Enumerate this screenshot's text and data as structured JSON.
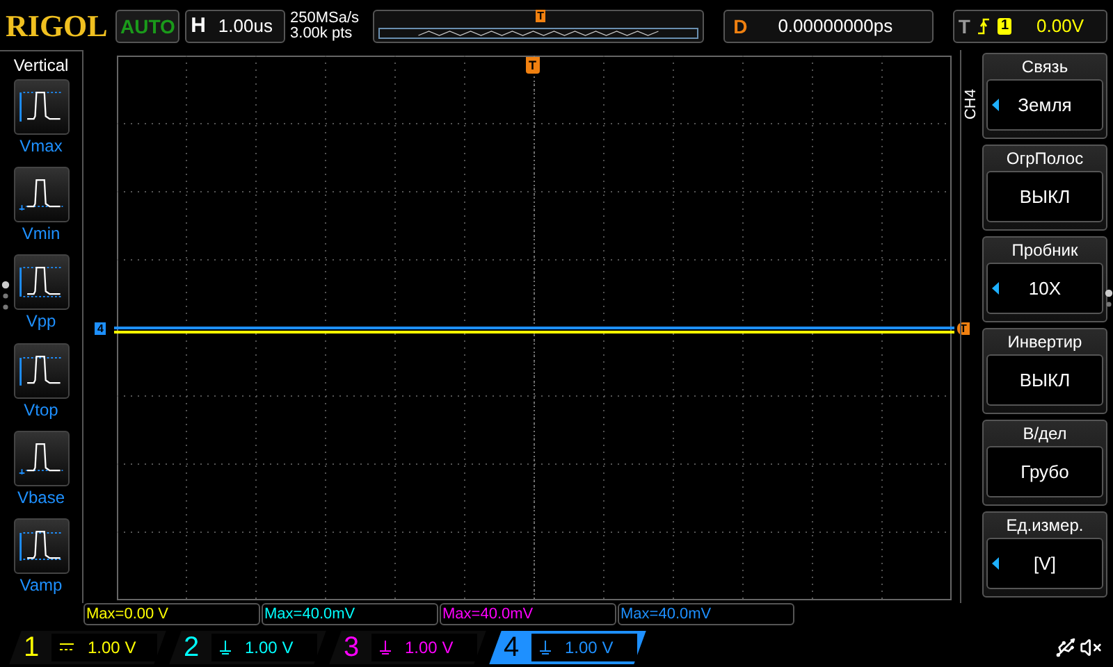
{
  "header": {
    "logo": "RIGOL",
    "run_status": "AUTO",
    "timebase": {
      "label": "H",
      "value": "1.00us"
    },
    "sample_rate": "250MSa/s",
    "memory_depth": "3.00k pts",
    "overview_marker": "T",
    "delay": {
      "label": "D",
      "value": "0.00000000ps"
    },
    "trigger": {
      "label": "T",
      "source": "1",
      "level": "0.00V"
    }
  },
  "left_menu": {
    "title": "Vertical",
    "items": [
      {
        "label": "Vmax",
        "kind": "max"
      },
      {
        "label": "Vmin",
        "kind": "min"
      },
      {
        "label": "Vpp",
        "kind": "pp"
      },
      {
        "label": "Vtop",
        "kind": "top"
      },
      {
        "label": "Vbase",
        "kind": "base"
      },
      {
        "label": "Vamp",
        "kind": "amp"
      }
    ]
  },
  "grid": {
    "channel_marker": "4",
    "trigger_level_marker": "T",
    "trigger_position_marker": "T"
  },
  "right_menu": {
    "tab": "CH4",
    "items": [
      {
        "title": "Связь",
        "value": "Земля",
        "arrow": true
      },
      {
        "title": "ОгрПолос",
        "value": "ВЫКЛ",
        "arrow": false
      },
      {
        "title": "Пробник",
        "value": "10X",
        "arrow": true
      },
      {
        "title": "Инвертир",
        "value": "ВЫКЛ",
        "arrow": false
      },
      {
        "title": "В/дел",
        "value": "Грубо",
        "arrow": false
      },
      {
        "title": "Ед.измер.",
        "value": "[V]",
        "arrow": true
      }
    ]
  },
  "measurements": [
    {
      "text": "Max=0.00 V",
      "color": "#ffff00"
    },
    {
      "text": "Max=40.0mV",
      "color": "#00ffff"
    },
    {
      "text": "Max=40.0mV",
      "color": "#ff00ff"
    },
    {
      "text": "Max=40.0mV",
      "color": "#1e90ff"
    }
  ],
  "channels": [
    {
      "number": "1",
      "kind": "dc",
      "scale": "1.00 V",
      "color": "#ffff00",
      "selected": false
    },
    {
      "number": "2",
      "kind": "gnd",
      "scale": "1.00 V",
      "color": "#00ffff",
      "selected": false
    },
    {
      "number": "3",
      "kind": "gnd",
      "scale": "1.00 V",
      "color": "#ff00ff",
      "selected": false
    },
    {
      "number": "4",
      "kind": "gnd",
      "scale": "1.00 V",
      "color": "#1e90ff",
      "selected": true
    }
  ]
}
